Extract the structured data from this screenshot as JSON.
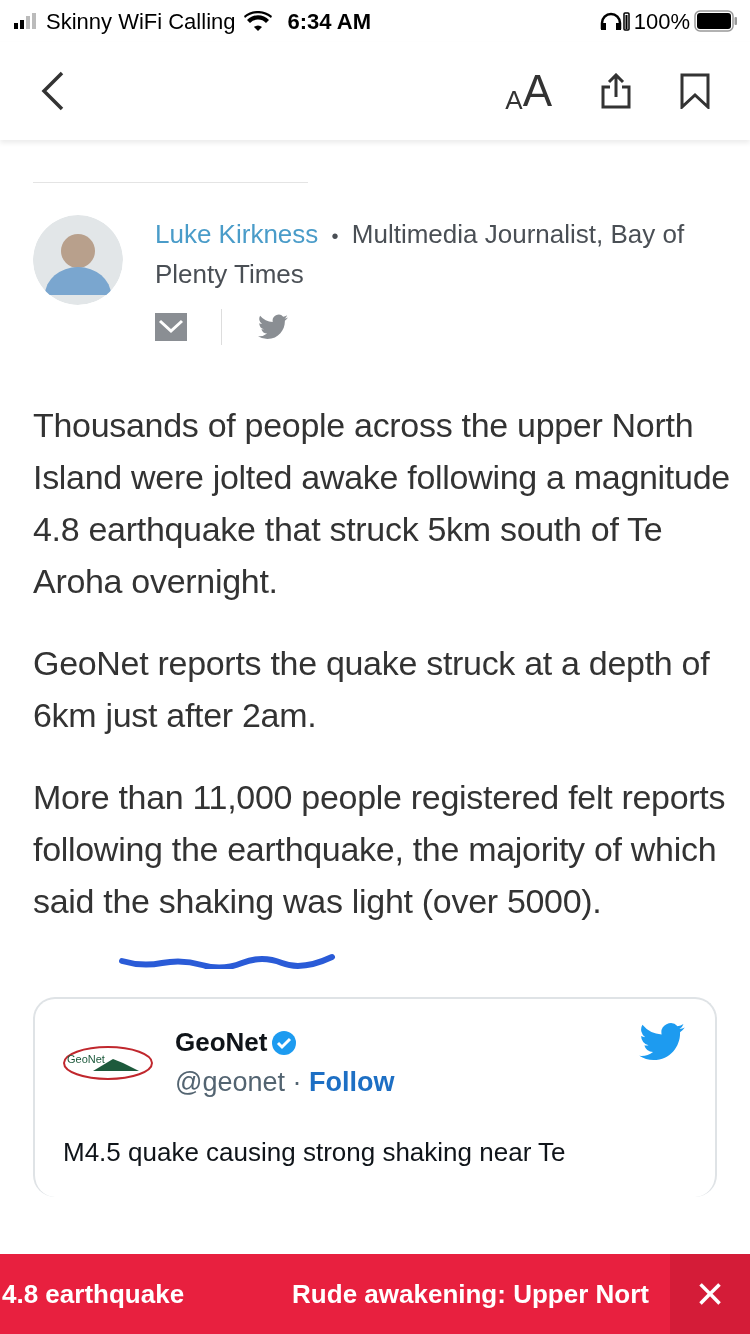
{
  "status_bar": {
    "carrier": "Skinny WiFi Calling",
    "time": "6:34 AM",
    "battery": "100%"
  },
  "toolbar": {
    "text_size": {
      "small": "A",
      "large": "A"
    }
  },
  "author": {
    "name": "Luke Kirkness",
    "separator": "•",
    "role": "Multimedia Journalist, Bay of Plenty Times"
  },
  "paragraphs": [
    "Thousands of people across the upper North Island were jolted awake following a magnitude 4.8 earthquake that struck 5km south of Te Aroha overnight.",
    "GeoNet reports the quake struck at a depth of 6km just after 2am.",
    "More than 11,000 people registered felt reports following the earthquake, the majority of which said the shaking was light (over 5000)."
  ],
  "tweet": {
    "logo_text": "GeoNet",
    "name": "GeoNet",
    "verified": true,
    "handle": "@geonet",
    "dot": "·",
    "follow": "Follow",
    "text": "M4.5 quake causing strong shaking near Te"
  },
  "ticker": {
    "items": [
      "4.8 earthquake",
      "Rude awakening: Upper Nort"
    ],
    "close": "×"
  }
}
